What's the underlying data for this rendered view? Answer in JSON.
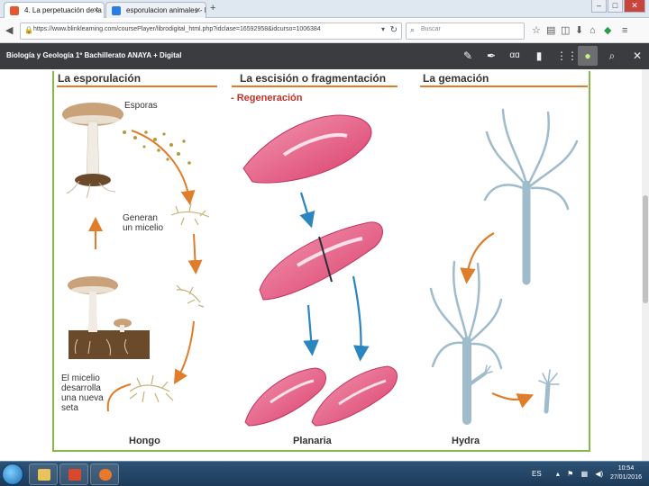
{
  "browser": {
    "tabs": [
      {
        "label": "4. La perpetuación de la vi...",
        "active": true
      },
      {
        "label": "esporulacion animales - Buscar ...",
        "active": false
      }
    ],
    "url": "https://www.blinklearning.com/coursePlayer/librodigital_html.php?idclase=16592958&idcurso=1006384",
    "search_placeholder": "Buscar",
    "window_buttons": [
      "–",
      "□",
      "✕"
    ]
  },
  "app": {
    "title": "Biología y Geología 1º Bachillerato ANAYA + Digital",
    "tools": [
      "pencil-icon",
      "marker-icon",
      "text-tool-icon",
      "bookmark-icon",
      "grid-icon",
      "location-icon",
      "search-icon",
      "close-icon"
    ]
  },
  "page": {
    "sections": [
      {
        "title": "La esporulación",
        "footer": "Hongo"
      },
      {
        "title": "La escisión o fragmentación",
        "footer": "Planaria"
      },
      {
        "title": "La gemación",
        "footer": "Hydra"
      }
    ],
    "labels": {
      "esporas": "Esporas",
      "micelio": [
        "Generan",
        "un micelio"
      ],
      "nueva_seta": [
        "El micelio",
        "desarrolla",
        "una nueva",
        "seta"
      ],
      "regeneracion": "- Regeneración"
    }
  },
  "taskbar": {
    "lang": "ES",
    "time": "10:54",
    "date": "27/01/2016"
  },
  "colors": {
    "accent": "#e07d2a",
    "frame": "#87b94a",
    "toolbar": "#3a3c3f",
    "planaria": "#e0557a",
    "hydra": "#9fbccd"
  }
}
